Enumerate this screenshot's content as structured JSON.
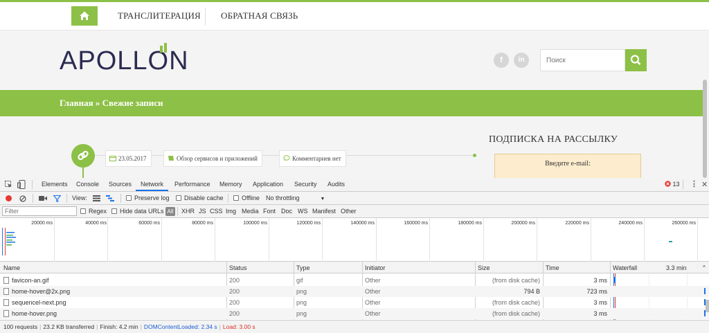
{
  "colors": {
    "brand_green": "#8dc046",
    "dom_content_loaded": "#1a5fd6",
    "load": "#d93025"
  },
  "site": {
    "nav": {
      "home_icon": "home-icon",
      "translit": "ТРАНСЛИТЕРАЦИЯ",
      "feedback": "ОБРАТНАЯ СВЯЗЬ"
    },
    "logo_text": "APOLLON",
    "social": {
      "facebook": "f",
      "linkedin": "in"
    },
    "search": {
      "placeholder": "Поиск",
      "icon": "search-icon"
    },
    "breadcrumb": "Главная » Свежие записи",
    "post_meta": {
      "date": "23.05.2017",
      "category": "Обзор сервисов и приложений",
      "comments": "Комментариев нет"
    },
    "subscribe": {
      "title": "ПОДПИСКА НА РАССЫЛКУ",
      "email_label": "Введите e-mail:"
    }
  },
  "devtools": {
    "tabs": [
      "Elements",
      "Console",
      "Sources",
      "Network",
      "Performance",
      "Memory",
      "Application",
      "Security",
      "Audits"
    ],
    "active_tab": "Network",
    "error_count": "13",
    "toolbar": {
      "view_label": "View:",
      "preserve_log": "Preserve log",
      "disable_cache": "Disable cache",
      "offline": "Offline",
      "throttling": "No throttling"
    },
    "filter": {
      "placeholder": "Filter",
      "regex": "Regex",
      "hide_data_urls": "Hide data URLs",
      "types": [
        "All",
        "XHR",
        "JS",
        "CSS",
        "Img",
        "Media",
        "Font",
        "Doc",
        "WS",
        "Manifest",
        "Other"
      ],
      "active_type": "All"
    },
    "overview_ticks": [
      "20000 ms",
      "40000 ms",
      "60000 ms",
      "80000 ms",
      "100000 ms",
      "120000 ms",
      "140000 ms",
      "160000 ms",
      "180000 ms",
      "200000 ms",
      "220000 ms",
      "240000 ms",
      "260000 ms"
    ],
    "columns": {
      "name": "Name",
      "status": "Status",
      "type": "Type",
      "initiator": "Initiator",
      "size": "Size",
      "time": "Time",
      "waterfall": "Waterfall",
      "waterfall_scale": "3.3 min"
    },
    "rows": [
      {
        "name": "favicon-an.gif",
        "status": "200",
        "type": "gif",
        "initiator": "Other",
        "size": "(from disk cache)",
        "time": "3 ms"
      },
      {
        "name": "home-hover@2x.png",
        "status": "200",
        "type": "png",
        "initiator": "Other",
        "size": "794 B",
        "time": "723 ms"
      },
      {
        "name": "sequencel-next.png",
        "status": "200",
        "type": "png",
        "initiator": "Other",
        "size": "(from disk cache)",
        "time": "3 ms"
      },
      {
        "name": "home-hover.png",
        "status": "200",
        "type": "png",
        "initiator": "Other",
        "size": "(from disk cache)",
        "time": "3 ms"
      }
    ],
    "summary": {
      "requests": "100 requests",
      "transferred": "23.2 KB transferred",
      "finish": "Finish: 4.2 min",
      "dom_content_loaded": "DOMContentLoaded: 2.34 s",
      "load": "Load: 3.00 s"
    }
  }
}
